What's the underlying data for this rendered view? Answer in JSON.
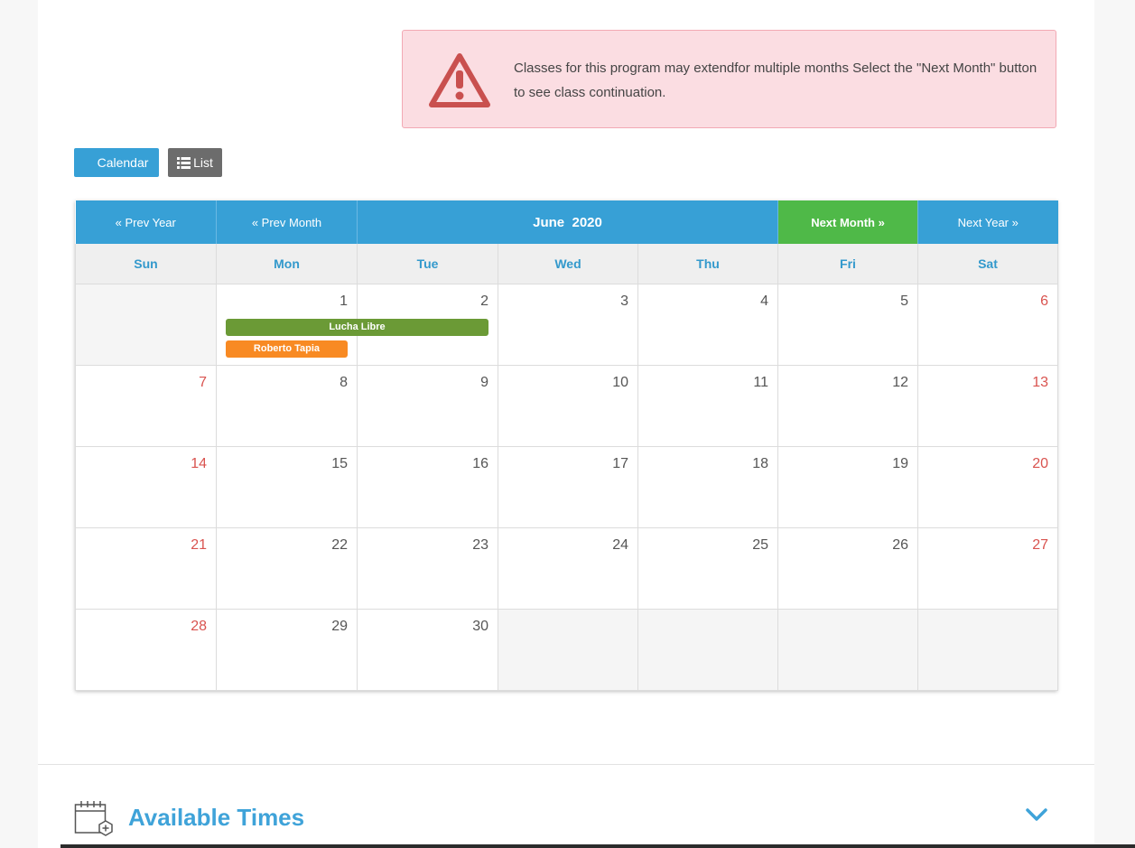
{
  "alert": {
    "message": "Classes for this program may extendfor multiple months Select the \"Next Month\" button to see class continuation.",
    "icon": "warning-triangle-icon"
  },
  "view_toggle": {
    "calendar_label": "Calendar",
    "list_label": "List"
  },
  "calendar": {
    "nav": {
      "prev_year": "« Prev Year",
      "prev_month": "« Prev Month",
      "month_title": "June  2020",
      "next_month": "Next Month »",
      "next_year": "Next Year »"
    },
    "weekdays": [
      "Sun",
      "Mon",
      "Tue",
      "Wed",
      "Thu",
      "Fri",
      "Sat"
    ],
    "weeks": [
      [
        "",
        "1",
        "2",
        "3",
        "4",
        "5",
        "6"
      ],
      [
        "7",
        "8",
        "9",
        "10",
        "11",
        "12",
        "13"
      ],
      [
        "14",
        "15",
        "16",
        "17",
        "18",
        "19",
        "20"
      ],
      [
        "21",
        "22",
        "23",
        "24",
        "25",
        "26",
        "27"
      ],
      [
        "28",
        "29",
        "30",
        "",
        "",
        "",
        ""
      ]
    ],
    "events": [
      {
        "label": "Lucha Libre",
        "color": "#6b9a36"
      },
      {
        "label": "Roberto Tapia",
        "color": "#f88a23"
      }
    ]
  },
  "available_times": {
    "title": "Available Times"
  },
  "colors": {
    "primary": "#37a0d6",
    "next_month": "#4fb948",
    "weekend": "#d9534f",
    "alert_bg": "#fbdde2"
  }
}
